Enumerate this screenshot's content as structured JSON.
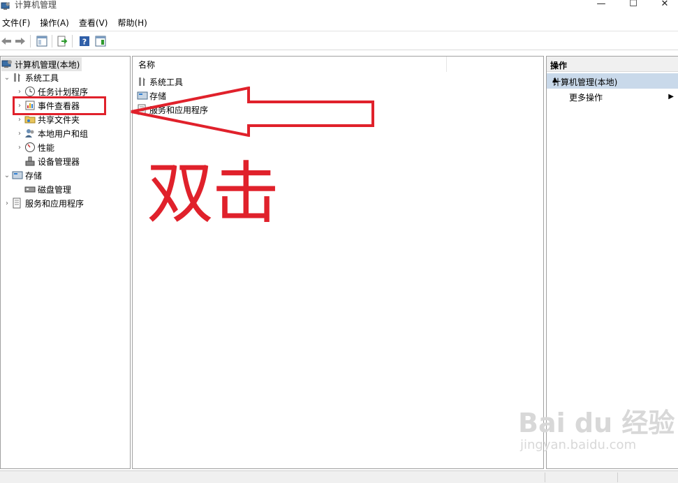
{
  "window": {
    "title": "计算机管理",
    "minimize_glyph": "—",
    "maximize_glyph": "☐",
    "close_glyph": "✕"
  },
  "menu": [
    "文件(F)",
    "操作(A)",
    "查看(V)",
    "帮助(H)"
  ],
  "toolbar": {
    "icons": [
      "back-arrow-icon",
      "forward-arrow-icon",
      "show-hide-tree-icon",
      "export-list-icon",
      "help-icon",
      "show-hide-action-pane-icon"
    ]
  },
  "tree": {
    "root": "计算机管理(本地)",
    "items": [
      {
        "label": "系统工具",
        "icon": "tools-icon",
        "expanded": true
      },
      {
        "label": "任务计划程序",
        "icon": "clock-icon"
      },
      {
        "label": "事件查看器",
        "icon": "event-viewer-icon"
      },
      {
        "label": "共享文件夹",
        "icon": "shared-folder-icon"
      },
      {
        "label": "本地用户和组",
        "icon": "users-icon"
      },
      {
        "label": "性能",
        "icon": "performance-icon"
      },
      {
        "label": "设备管理器",
        "icon": "device-manager-icon"
      },
      {
        "label": "存储",
        "icon": "storage-icon",
        "expanded": true
      },
      {
        "label": "磁盘管理",
        "icon": "disk-icon"
      },
      {
        "label": "服务和应用程序",
        "icon": "services-icon"
      }
    ]
  },
  "center": {
    "column_name": "名称",
    "items": [
      {
        "label": "系统工具",
        "icon": "tools-icon"
      },
      {
        "label": "存储",
        "icon": "storage-icon"
      },
      {
        "label": "服务和应用程序",
        "icon": "services-icon"
      }
    ]
  },
  "actions": {
    "header": "操作",
    "section": "计算机管理(本地)",
    "more_actions": "更多操作"
  },
  "annotation": {
    "text": "双击",
    "color": "#e0212b"
  },
  "watermark": {
    "main": "Bai du 经验",
    "sub": "jingyan.baidu.com"
  }
}
